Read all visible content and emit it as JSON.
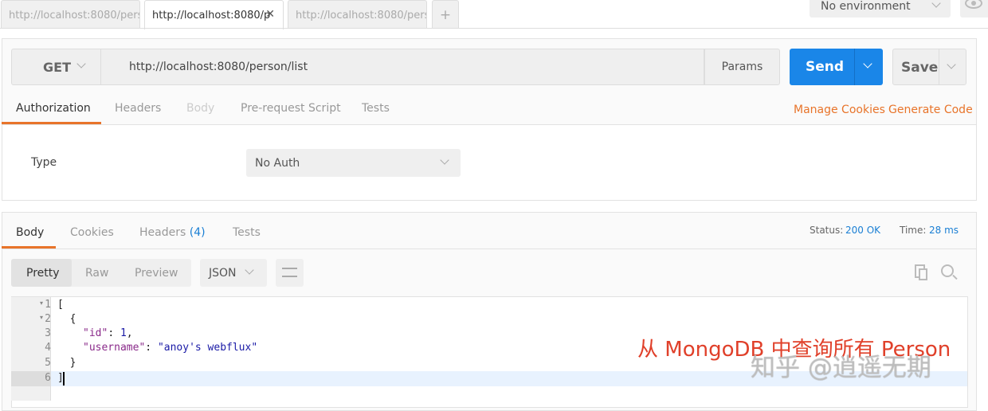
{
  "tabs": [
    {
      "label": "http://localhost:8080/pers",
      "active": false
    },
    {
      "label": "http://localhost:8080/p",
      "active": true
    },
    {
      "label": "http://localhost:8080/pers",
      "active": false
    }
  ],
  "new_tab_label": "+",
  "close_label": "✕",
  "environment": {
    "selected": "No environment"
  },
  "request": {
    "method": "GET",
    "url": "http://localhost:8080/person/list",
    "params_label": "Params",
    "send_label": "Send",
    "save_label": "Save"
  },
  "request_tabs": [
    {
      "label": "Authorization",
      "active": true
    },
    {
      "label": "Headers"
    },
    {
      "label": "Body",
      "disabled": true
    },
    {
      "label": "Pre-request Script"
    },
    {
      "label": "Tests"
    }
  ],
  "links": {
    "manage_cookies": "Manage Cookies",
    "generate_code": "Generate Code"
  },
  "auth": {
    "type_label": "Type",
    "type_value": "No Auth"
  },
  "response_tabs": [
    {
      "label": "Body",
      "active": true
    },
    {
      "label": "Cookies"
    },
    {
      "label": "Headers",
      "count": "(4)"
    },
    {
      "label": "Tests"
    }
  ],
  "status": {
    "status_label": "Status:",
    "status_value": "200 OK",
    "time_label": "Time:",
    "time_value": "28 ms"
  },
  "view_modes": {
    "pretty": "Pretty",
    "raw": "Raw",
    "preview": "Preview",
    "format": "JSON"
  },
  "code_lines": [
    {
      "n": "1",
      "text": "["
    },
    {
      "n": "2",
      "text": "  {"
    },
    {
      "n": "3",
      "key": "\"id\"",
      "value": "1",
      "suffix": ","
    },
    {
      "n": "4",
      "key": "\"username\"",
      "value": "\"anoy's webflux\"",
      "suffix": ""
    },
    {
      "n": "5",
      "text": "  }"
    },
    {
      "n": "6",
      "text": "]"
    }
  ],
  "annotation": "从 MongoDB 中查询所有 Person",
  "watermark": "知乎 @逍遥无期",
  "colors": {
    "accent": "#e8742a",
    "send": "#1a86e8",
    "link": "#1a7fd4",
    "annotation": "#e0402a"
  }
}
